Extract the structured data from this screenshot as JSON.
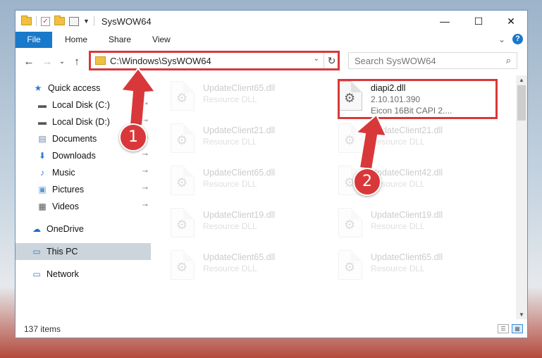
{
  "window": {
    "title": "SysWOW64",
    "controls": {
      "minimize": "—",
      "maximize": "☐",
      "close": "✕"
    }
  },
  "ribbon": {
    "tabs": [
      "File",
      "Home",
      "Share",
      "View"
    ],
    "expand_glyph": "⌄",
    "help_glyph": "?"
  },
  "nav": {
    "back": "←",
    "forward": "→",
    "recent": "⌄",
    "up": "↑",
    "address": "C:\\Windows\\SysWOW64",
    "address_dropdown": "⌄",
    "refresh": "↻",
    "search_placeholder": "Search SysWOW64",
    "search_glyph": "⌕"
  },
  "sidebar": {
    "items": [
      {
        "label": "Quick access",
        "icon": "star-icon",
        "glyph": "★",
        "color": "#2e7bd6",
        "pinned": false
      },
      {
        "label": "Local Disk (C:)",
        "icon": "drive-icon",
        "glyph": "▬",
        "color": "#555555",
        "pinned": true
      },
      {
        "label": "Local Disk (D:)",
        "icon": "drive-icon",
        "glyph": "▬",
        "color": "#555555",
        "pinned": true
      },
      {
        "label": "Documents",
        "icon": "documents-icon",
        "glyph": "▤",
        "color": "#6a86a8",
        "pinned": true
      },
      {
        "label": "Downloads",
        "icon": "download-icon",
        "glyph": "⬇",
        "color": "#2e7bd6",
        "pinned": true
      },
      {
        "label": "Music",
        "icon": "music-icon",
        "glyph": "♪",
        "color": "#2e7bd6",
        "pinned": true
      },
      {
        "label": "Pictures",
        "icon": "pictures-icon",
        "glyph": "▣",
        "color": "#5a9bd5",
        "pinned": true
      },
      {
        "label": "Videos",
        "icon": "videos-icon",
        "glyph": "▦",
        "color": "#555555",
        "pinned": true
      },
      {
        "label": "OneDrive",
        "icon": "cloud-icon",
        "glyph": "☁",
        "color": "#1a6fd1",
        "pinned": false
      },
      {
        "label": "This PC",
        "icon": "computer-icon",
        "glyph": "▭",
        "color": "#2e7bd6",
        "pinned": false
      },
      {
        "label": "Network",
        "icon": "network-icon",
        "glyph": "▭",
        "color": "#2e7bd6",
        "pinned": false
      }
    ],
    "pin_glyph": "📌"
  },
  "files": [
    {
      "name": "UpdateClient65.dll",
      "sub1": "Resource DLL",
      "sub2": "",
      "faded": true
    },
    {
      "name": "diapi2.dll",
      "sub1": "2.10.101.390",
      "sub2": "Eicon 16Bit CAPI 2....",
      "faded": false
    },
    {
      "name": "UpdateClient21.dll",
      "sub1": "Resource DLL",
      "sub2": "",
      "faded": true
    },
    {
      "name": "UpdateClient21.dll",
      "sub1": "Resource DLL",
      "sub2": "",
      "faded": true
    },
    {
      "name": "UpdateClient65.dll",
      "sub1": "Resource DLL",
      "sub2": "",
      "faded": true
    },
    {
      "name": "UpdateClient42.dll",
      "sub1": "Resource DLL",
      "sub2": "",
      "faded": true
    },
    {
      "name": "UpdateClient19.dll",
      "sub1": "Resource DLL",
      "sub2": "",
      "faded": true
    },
    {
      "name": "UpdateClient19.dll",
      "sub1": "Resource DLL",
      "sub2": "",
      "faded": true
    },
    {
      "name": "UpdateClient65.dll",
      "sub1": "Resource DLL",
      "sub2": "",
      "faded": true
    },
    {
      "name": "UpdateClient65.dll",
      "sub1": "Resource DLL",
      "sub2": "",
      "faded": true
    }
  ],
  "status": {
    "item_count": "137 items"
  },
  "annotations": {
    "step1": "1",
    "step2": "2",
    "color": "#d9383a"
  }
}
